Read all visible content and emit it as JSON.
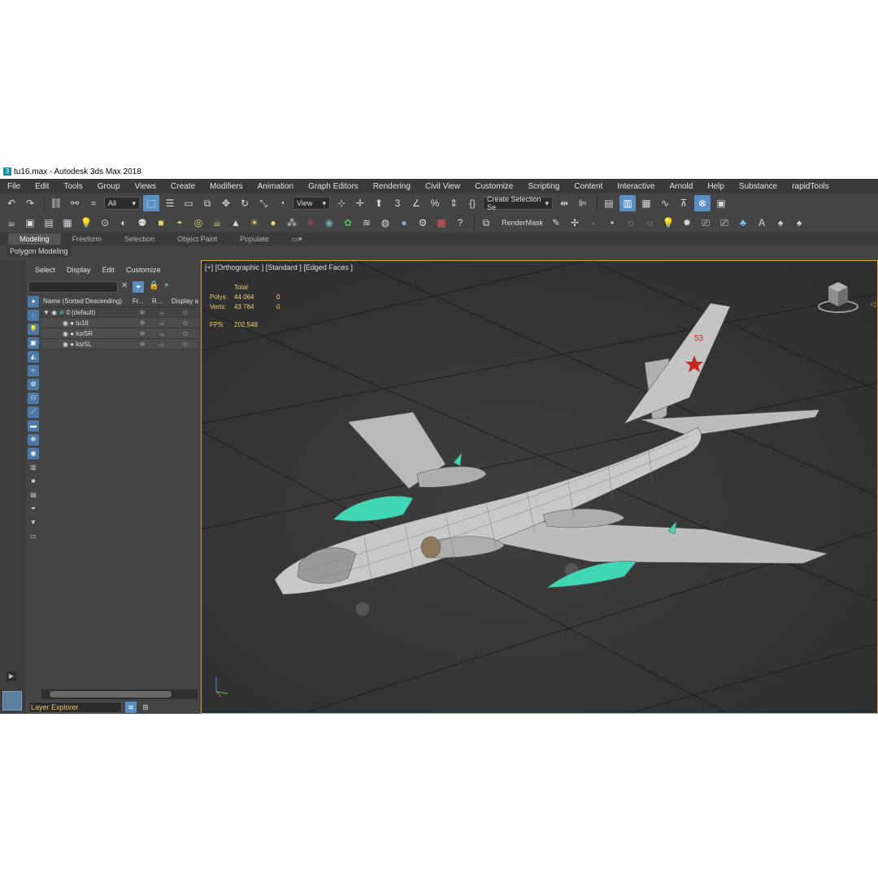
{
  "window": {
    "title": "tu16.max - Autodesk 3ds Max 2018",
    "app_icon": "3"
  },
  "menu": [
    "File",
    "Edit",
    "Tools",
    "Group",
    "Views",
    "Create",
    "Modifiers",
    "Animation",
    "Graph Editors",
    "Rendering",
    "Civil View",
    "Customize",
    "Scripting",
    "Content",
    "Interactive",
    "Arnold",
    "Help",
    "Substance",
    "rapidTools"
  ],
  "toolbar": {
    "filter_value": "All",
    "view_value": "View",
    "selection_set": "Create Selection Se",
    "render_mask": "RenderMask"
  },
  "ribbon": {
    "tabs": [
      "Modeling",
      "Freeform",
      "Selection",
      "Object Paint",
      "Populate"
    ],
    "panel_label": "Polygon Modeling"
  },
  "explorer": {
    "menu": [
      "Select",
      "Display",
      "Edit",
      "Customize"
    ],
    "columns": [
      "Name (Sorted Descending)",
      "Fr...",
      "R...",
      "Display a"
    ],
    "rows": [
      {
        "name": "0 (default)"
      },
      {
        "name": "tu16"
      },
      {
        "name": "ksr5R"
      },
      {
        "name": "ksr5L"
      }
    ],
    "footer_label": "Layer Explorer"
  },
  "viewport": {
    "label": "[+] [Orthographic ] [Standard ] [Edged Faces ]",
    "stats": {
      "total_label": "Total",
      "polys_label": "Polys:",
      "polys_value": "44 064",
      "polys_sel": "0",
      "verts_label": "Verts:",
      "verts_value": "43 764",
      "verts_sel": "0",
      "fps_label": "FPS:",
      "fps_value": "202,548"
    },
    "tail_marking": "53"
  },
  "colors": {
    "accent": "#5a8fc4",
    "viewport_border": "#d9a63a",
    "stats": "#e8d36b",
    "missile": "#3fd6b4",
    "star": "#cc2222"
  }
}
